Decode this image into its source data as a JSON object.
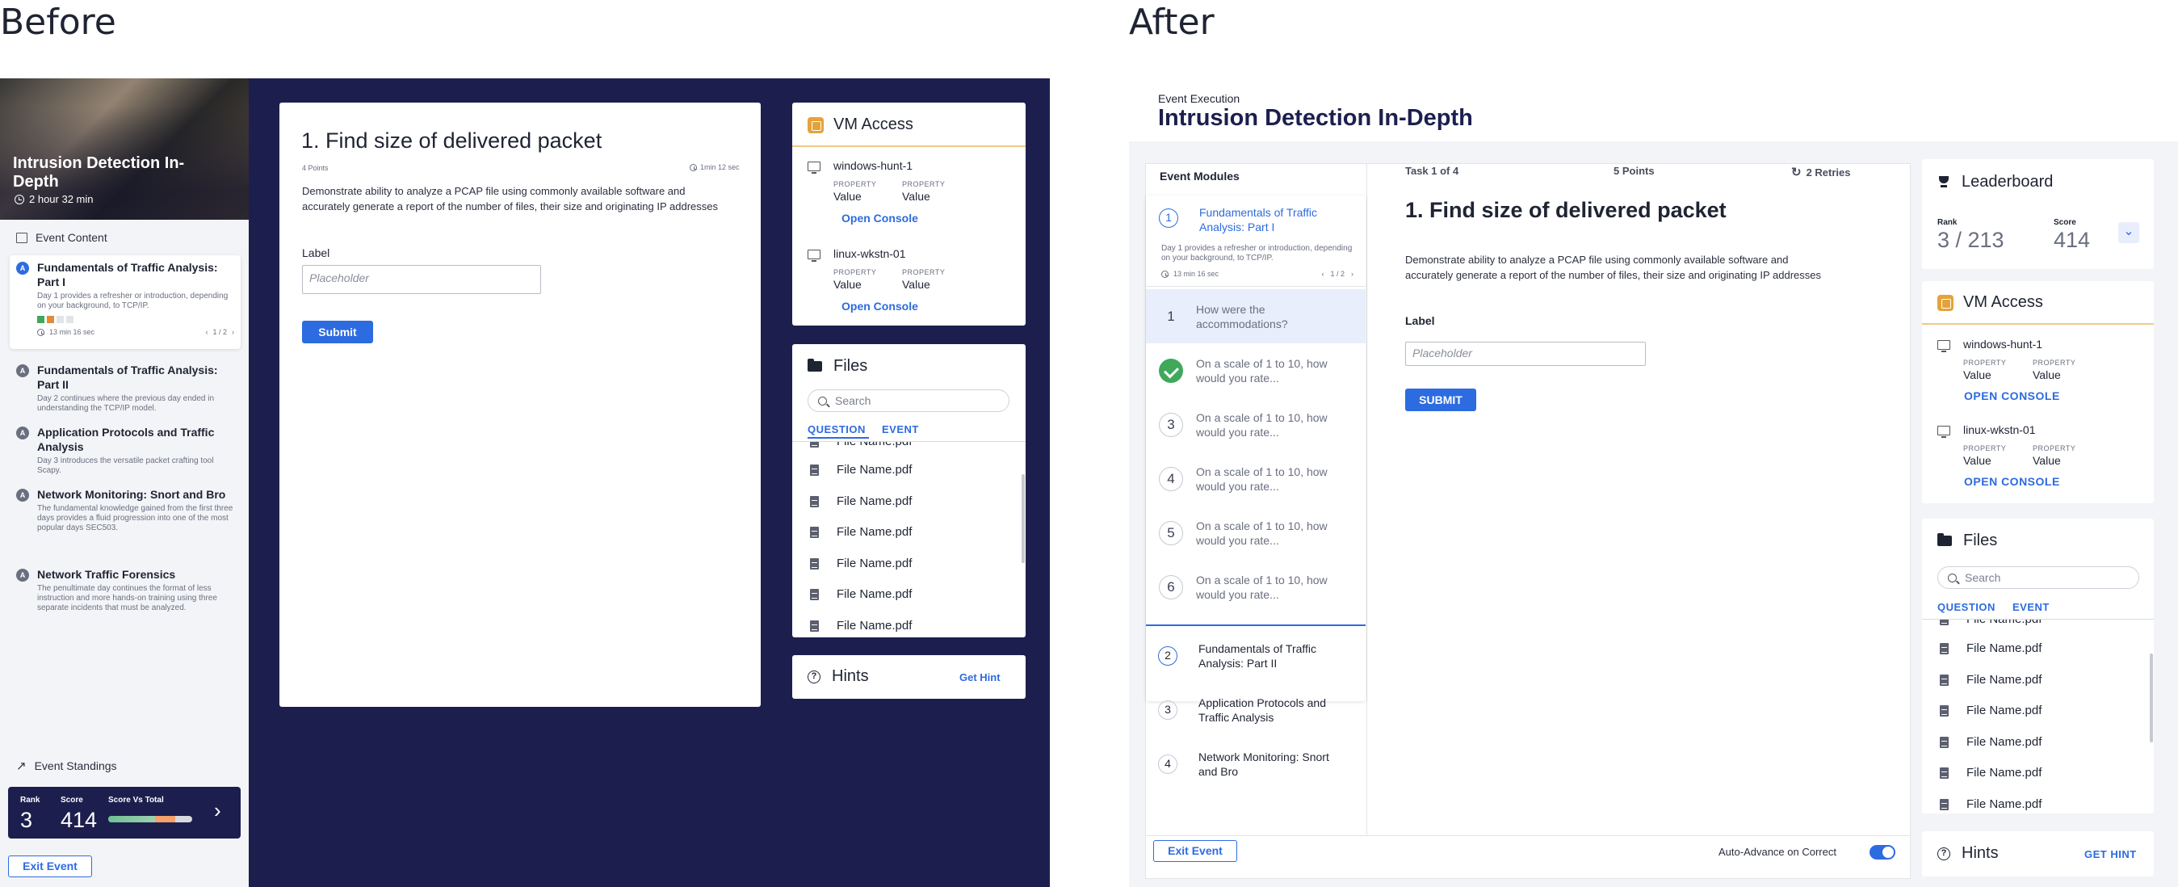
{
  "headings": {
    "before": "Before",
    "after": "After"
  },
  "before": {
    "event": {
      "title": "Intrusion Detection In-Depth",
      "duration": "2 hour 32 min"
    },
    "content_label": "Event Content",
    "modules": [
      {
        "badge": "A",
        "title": "Fundamentals of Traffic Analysis: Part I",
        "desc": "Day 1 provides a refresher or introduction, depending on your background, to TCP/IP.",
        "time": "13 min 16 sec",
        "pager": "1 / 2",
        "active": true
      },
      {
        "badge": "A",
        "title": "Fundamentals of Traffic Analysis: Part II",
        "desc": "Day 2 continues where the previous day ended in understanding the TCP/IP model."
      },
      {
        "badge": "A",
        "title": "Application Protocols and Traffic Analysis",
        "desc": "Day 3 introduces the versatile packet crafting tool Scapy."
      },
      {
        "badge": "A",
        "title": "Network Monitoring: Snort and Bro",
        "desc": "The fundamental knowledge gained from the first three days provides a fluid progression into one of the most popular days SEC503."
      },
      {
        "badge": "A",
        "title": "Network Traffic Forensics",
        "desc": "The penultimate day continues the format of less instruction and more hands-on training using three separate incidents that must be analyzed."
      }
    ],
    "standings": {
      "label": "Event Standings",
      "rank_label": "Rank",
      "rank": "3",
      "score_label": "Score",
      "score": "414",
      "svt_label": "Score Vs Total",
      "progress": 0.8
    },
    "exit_label": "Exit Event",
    "question": {
      "title": "1. Find size of delivered packet",
      "points": "4 Points",
      "timer": "1min 12 sec",
      "body": "Demonstrate ability to analyze a PCAP file using commonly available software and accurately generate a report of the number of files, their size and  originating IP addresses",
      "field_label": "Label",
      "placeholder": "Placeholder",
      "submit": "Submit"
    },
    "vm": {
      "title": "VM Access",
      "machines": [
        {
          "name": "windows-hunt-1",
          "prop1_label": "PROPERTY",
          "prop1_value": "Value",
          "prop2_label": "PROPERTY",
          "prop2_value": "Value",
          "action": "Open Console"
        },
        {
          "name": "linux-wkstn-01",
          "prop1_label": "PROPERTY",
          "prop1_value": "Value",
          "prop2_label": "PROPERTY",
          "prop2_value": "Value",
          "action": "Open Console"
        }
      ]
    },
    "files": {
      "title": "Files",
      "search_placeholder": "Search",
      "tabs": [
        "QUESTION",
        "EVENT"
      ],
      "items": [
        "File Name.pdf",
        "File Name.pdf",
        "File Name.pdf",
        "File Name.pdf",
        "File Name.pdf",
        "File Name.pdf",
        "File Name.pdf"
      ]
    },
    "hints": {
      "title": "Hints",
      "action": "Get Hint"
    }
  },
  "after": {
    "eyebrow": "Event Execution",
    "title": "Intrusion Detection In-Depth",
    "modules_label": "Event Modules",
    "active_module": {
      "num": "1",
      "title": "Fundamentals of Traffic Analysis: Part I",
      "desc": "Day 1 provides a refresher or introduction, depending on your background, to TCP/IP.",
      "time": "13 min 16 sec",
      "pager": "1 / 2"
    },
    "questions": [
      {
        "num": "1",
        "text": "How were the accommodations?",
        "state": "current"
      },
      {
        "num": "",
        "text": "On a scale of 1 to 10, how would you rate...",
        "state": "done"
      },
      {
        "num": "3",
        "text": "On a scale of 1 to 10, how would you rate...",
        "state": "todo"
      },
      {
        "num": "4",
        "text": "On a scale of 1 to 10, how would you rate...",
        "state": "todo"
      },
      {
        "num": "5",
        "text": "On a scale of 1 to 10, how would you rate...",
        "state": "todo"
      },
      {
        "num": "6",
        "text": "On a scale of 1 to 10, how would you rate...",
        "state": "todo"
      }
    ],
    "other_modules": [
      {
        "num": "2",
        "title": "Fundamentals of Traffic Analysis: Part II"
      },
      {
        "num": "3",
        "title": "Application Protocols and Traffic Analysis"
      },
      {
        "num": "4",
        "title": "Network Monitoring: Snort and Bro"
      }
    ],
    "task": {
      "counter": "Task 1 of 4",
      "points": "5 Points",
      "retries": "2 Retries",
      "title": "1. Find size of delivered packet",
      "body": "Demonstrate ability to analyze a PCAP file using commonly available software and accurately generate a report of the number of files, their size and  originating IP addresses",
      "field_label": "Label",
      "placeholder": "Placeholder",
      "submit": "SUBMIT"
    },
    "exit_label": "Exit Event",
    "auto_advance": "Auto-Advance on Correct",
    "leaderboard": {
      "title": "Leaderboard",
      "rank_label": "Rank",
      "rank": "3 / 213",
      "score_label": "Score",
      "score": "414"
    },
    "vm": {
      "title": "VM Access",
      "machines": [
        {
          "name": "windows-hunt-1",
          "prop1_label": "PROPERTY",
          "prop1_value": "Value",
          "prop2_label": "PROPERTY",
          "prop2_value": "Value",
          "action": "OPEN CONSOLE"
        },
        {
          "name": "linux-wkstn-01",
          "prop1_label": "PROPERTY",
          "prop1_value": "Value",
          "prop2_label": "PROPERTY",
          "prop2_value": "Value",
          "action": "OPEN CONSOLE"
        }
      ]
    },
    "files": {
      "title": "Files",
      "search_placeholder": "Search",
      "tabs": [
        "QUESTION",
        "EVENT"
      ],
      "items": [
        "File Name.pdf",
        "File Name.pdf",
        "File Name.pdf",
        "File Name.pdf",
        "File Name.pdf",
        "File Name.pdf",
        "File Name.pdf"
      ]
    },
    "hints": {
      "title": "Hints",
      "action": "GET HINT"
    }
  }
}
